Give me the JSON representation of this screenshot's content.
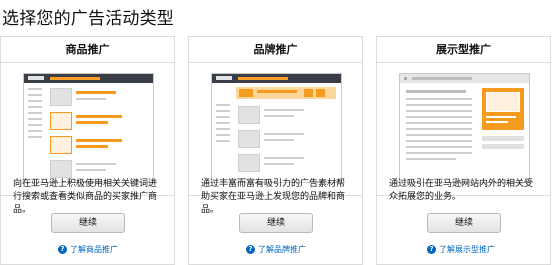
{
  "page": {
    "title": "选择您的广告活动类型"
  },
  "cards": [
    {
      "title": "商品推广",
      "description": "向在亚马逊上积极使用相关关键词进行搜索或查看类似商品的买家推广商品。",
      "button": "继续",
      "learn_more": "了解商品推广"
    },
    {
      "title": "品牌推广",
      "description": "通过丰富而富有吸引力的广告素材帮助买家在亚马逊上发现您的品牌和商品。",
      "button": "继续",
      "learn_more": "了解品牌推广"
    },
    {
      "title": "展示型推广",
      "description": "通过吸引在亚马逊网站内外的相关受众拓展您的业务。",
      "button": "继续",
      "learn_more": "了解展示型推广"
    }
  ],
  "icons": {
    "help": "help-circle-icon"
  },
  "colors": {
    "link": "#0066c0",
    "accent": "#f59b1f",
    "header_bar": "#3a3f47"
  }
}
